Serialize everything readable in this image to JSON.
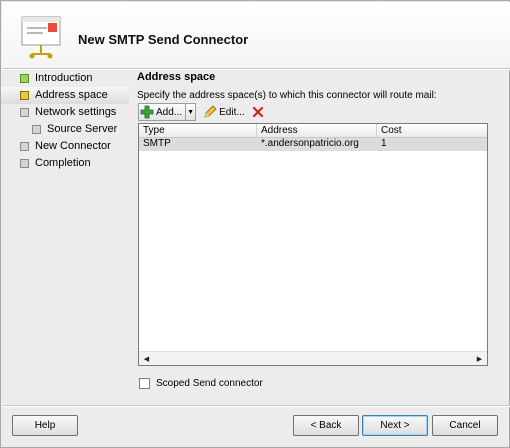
{
  "window": {
    "title": "New SMTP Send Connector"
  },
  "steps": [
    {
      "label": "Introduction",
      "state": "done"
    },
    {
      "label": "Address space",
      "state": "current"
    },
    {
      "label": "Network settings",
      "state": "pending"
    },
    {
      "label": "Source Server",
      "state": "pending",
      "sub": true
    },
    {
      "label": "New Connector",
      "state": "pending"
    },
    {
      "label": "Completion",
      "state": "pending"
    }
  ],
  "page": {
    "section_title": "Address space",
    "instruction": "Specify the address space(s) to which this connector will route mail:"
  },
  "toolbar": {
    "add_label": "Add...",
    "edit_label": "Edit..."
  },
  "list": {
    "columns": [
      "Type",
      "Address",
      "Cost"
    ],
    "rows": [
      {
        "type": "SMTP",
        "address": "*.andersonpatricio.org",
        "cost": "1"
      }
    ]
  },
  "options": {
    "scoped_label": "Scoped Send connector",
    "scoped_checked": false
  },
  "buttons": {
    "help": "Help",
    "back": "< Back",
    "next": "Next >",
    "cancel": "Cancel"
  },
  "colors": {
    "done_step": "#9fd45a",
    "current_step": "#e8c84a",
    "selected_row": "#dcdcdc",
    "remove_icon": "#d42020",
    "add_icon": "#3aa33a"
  }
}
